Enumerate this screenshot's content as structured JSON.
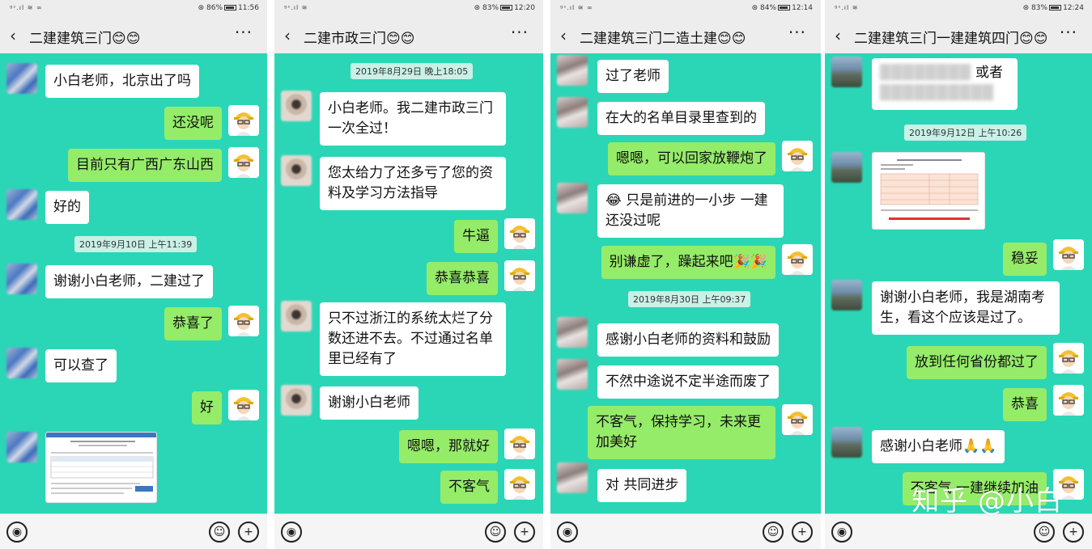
{
  "panels": [
    {
      "status": {
        "signal": "ᵍˢ.ıl ≋ ∞",
        "right": "⊛ 86%",
        "time": "11:56"
      },
      "title": "二建建筑三门😊😊",
      "messages": [
        {
          "text": "小白老师，北京出了吗"
        },
        {
          "text": "还没呢"
        },
        {
          "text": "目前只有广西广东山西"
        },
        {
          "text": "好的"
        },
        {
          "text": "谢谢小白老师，二建过了"
        },
        {
          "text": "恭喜了"
        },
        {
          "text": "可以查了"
        },
        {
          "text": "好"
        }
      ],
      "timestamps": [
        "2019年9月10日 上午11:39"
      ]
    },
    {
      "status": {
        "signal": "ᵍˢ.ıl ≋",
        "right": "⊛ 83%",
        "time": "12:20"
      },
      "title": "二建市政三门😊😊",
      "messages": [
        {
          "text": "小白老师。我二建市政三门一次全过！"
        },
        {
          "text": "您太给力了还多亏了您的资料及学习方法指导"
        },
        {
          "text": "牛逼"
        },
        {
          "text": "恭喜恭喜"
        },
        {
          "text": "只不过浙江的系统太烂了分数还进不去。不过通过名单里已经有了"
        },
        {
          "text": "谢谢小白老师"
        },
        {
          "text": "嗯嗯，那就好"
        },
        {
          "text": "不客气"
        }
      ],
      "timestamps": [
        "2019年8月29日 晚上18:05"
      ]
    },
    {
      "status": {
        "signal": "ᵍˢ.ıl ≋ ∞",
        "right": "⊛ 84%",
        "time": "12:14"
      },
      "title": "二建建筑三门二造土建😊😊",
      "messages": [
        {
          "text": "过了老师"
        },
        {
          "text": "在大的名单目录里查到的"
        },
        {
          "text": "嗯嗯，可以回家放鞭炮了"
        },
        {
          "text": "😂 只是前进的一小步 一建还没过呢"
        },
        {
          "text": "别谦虚了，躁起来吧🎉🎉"
        },
        {
          "text": "感谢小白老师的资料和鼓励"
        },
        {
          "text": "不然中途说不定半途而废了"
        },
        {
          "text": "不客气，保持学习，未来更加美好"
        },
        {
          "text": "对 共同进步"
        }
      ],
      "timestamps": [
        "2019年8月30日 上午09:37"
      ]
    },
    {
      "status": {
        "signal": "ᵍˢ.ıl ≋",
        "right": "⊛ 83%",
        "time": "12:24"
      },
      "title": "二建建筑三门一建建筑四门😊😊",
      "messages": [
        {
          "text": "或者"
        },
        {
          "text": "稳妥"
        },
        {
          "text": "谢谢小白老师，我是湖南考生，看这个应该是过了。"
        },
        {
          "text": "放到任何省份都过了"
        },
        {
          "text": "恭喜"
        },
        {
          "text": "感谢小白老师🙏🙏"
        },
        {
          "text": "不客气 一建继续加油"
        }
      ],
      "timestamps": [
        "2019年9月12日 上午10:26"
      ]
    }
  ],
  "common": {
    "back": "‹",
    "more": "···",
    "voice": "◉",
    "emoji": "☺",
    "plus": "+"
  },
  "watermark": "知乎 @小白",
  "icons": [
    "back-icon",
    "more-icon",
    "voice-icon",
    "emoji-icon",
    "plus-icon"
  ]
}
